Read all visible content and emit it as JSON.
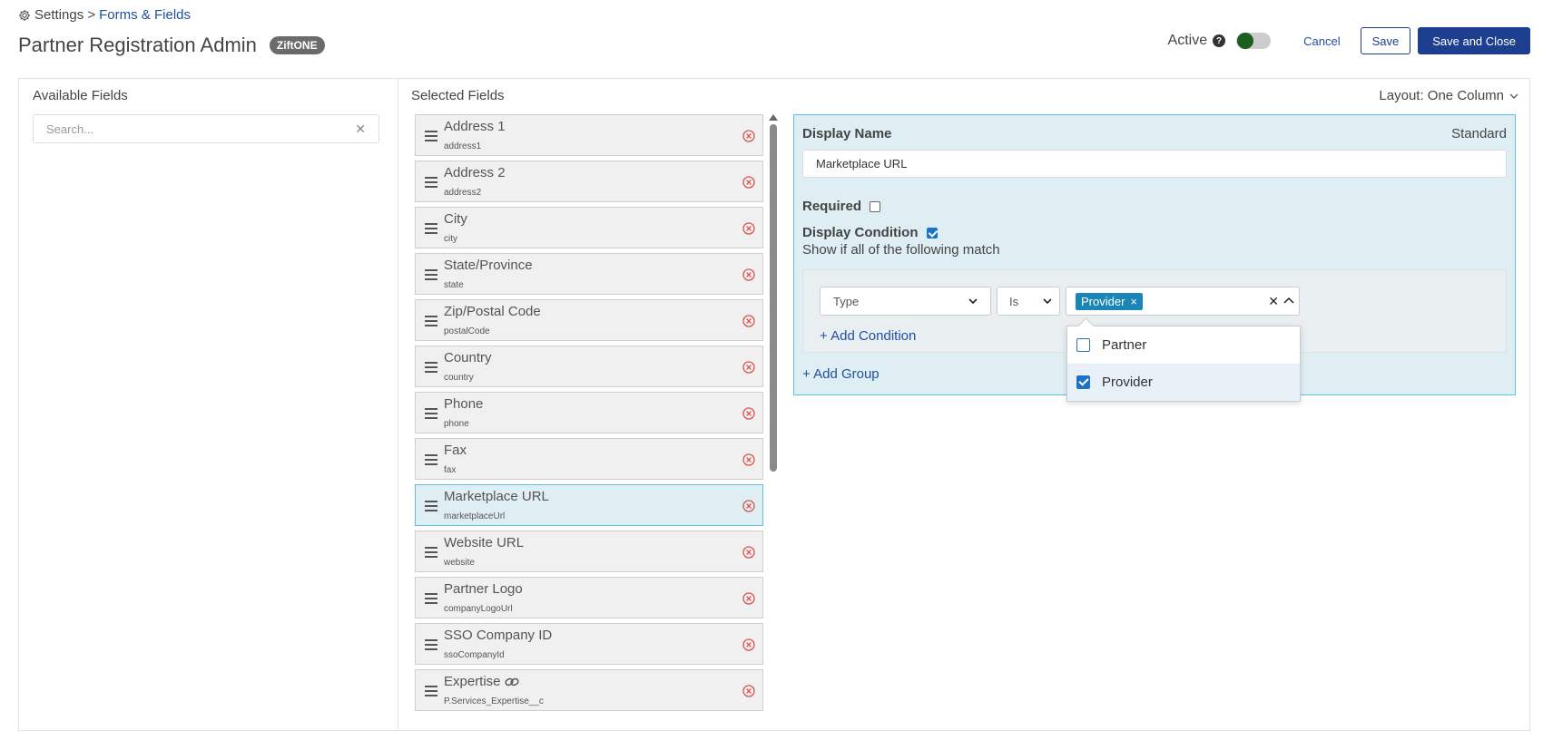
{
  "breadcrumb": {
    "settings": "Settings >",
    "current": "Forms & Fields"
  },
  "header": {
    "title": "Partner Registration Admin",
    "badge": "ZiftONE",
    "active_label": "Active",
    "help_glyph": "?",
    "cancel": "Cancel",
    "save": "Save",
    "save_close": "Save and Close"
  },
  "available": {
    "title": "Available Fields",
    "search_placeholder": "Search...",
    "clear_glyph": "✕"
  },
  "selected": {
    "title": "Selected Fields",
    "layout": "Layout: One Column",
    "fields": [
      {
        "label": "Address 1",
        "key": "address1"
      },
      {
        "label": "Address 2",
        "key": "address2"
      },
      {
        "label": "City",
        "key": "city"
      },
      {
        "label": "State/Province",
        "key": "state"
      },
      {
        "label": "Zip/Postal Code",
        "key": "postalCode"
      },
      {
        "label": "Country",
        "key": "country"
      },
      {
        "label": "Phone",
        "key": "phone"
      },
      {
        "label": "Fax",
        "key": "fax"
      },
      {
        "label": "Marketplace URL",
        "key": "marketplaceUrl"
      },
      {
        "label": "Website URL",
        "key": "website"
      },
      {
        "label": "Partner Logo",
        "key": "companyLogoUrl"
      },
      {
        "label": "SSO Company ID",
        "key": "ssoCompanyId"
      },
      {
        "label": "Expertise",
        "key": "P.Services_Expertise__c"
      }
    ]
  },
  "detail": {
    "display_name_label": "Display Name",
    "standard": "Standard",
    "display_name_value": "Marketplace URL",
    "required_label": "Required",
    "display_condition_label": "Display Condition",
    "show_if": "Show if all of the following match",
    "condition": {
      "field": "Type",
      "operator": "Is",
      "tag": "Provider",
      "tag_remove": "×",
      "clear_glyph": "✕"
    },
    "add_condition": "+ Add Condition",
    "add_group": "+ Add Group"
  },
  "dropdown": {
    "options": [
      {
        "label": "Partner",
        "checked": false
      },
      {
        "label": "Provider",
        "checked": true
      }
    ]
  },
  "colors": {
    "primary": "#1e3f8f",
    "link": "#1f4fa3",
    "tag": "#1a86b8",
    "selected_bg": "#dfeef2",
    "selected_border": "#5cc1e0",
    "toggle_knob": "#1b5e20",
    "remove_red": "#d9534f"
  }
}
